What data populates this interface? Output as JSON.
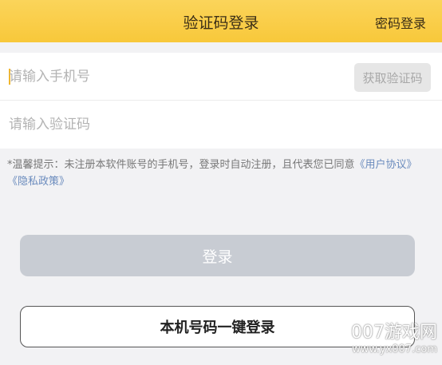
{
  "header": {
    "title": "验证码登录",
    "right_link": "密码登录"
  },
  "form": {
    "phone": {
      "placeholder": "请输入手机号",
      "value": ""
    },
    "get_code_label": "获取验证码",
    "code": {
      "placeholder": "请输入验证码",
      "value": ""
    }
  },
  "tip": {
    "prefix": "*温馨提示：未注册本软件账号的手机号，登录时自动注册，且代表您已同意",
    "user_agreement": "《用户协议》",
    "separator": " ",
    "privacy_policy": "《隐私政策》"
  },
  "buttons": {
    "login_label": "登录",
    "onekey_label": "本机号码一键登录"
  },
  "watermark": {
    "main": "007游戏网",
    "sub": "www.yx007.com"
  },
  "colors": {
    "header_bg": "#f8c83a",
    "link": "#6a8bbd",
    "login_disabled": "#c8ccd3"
  }
}
